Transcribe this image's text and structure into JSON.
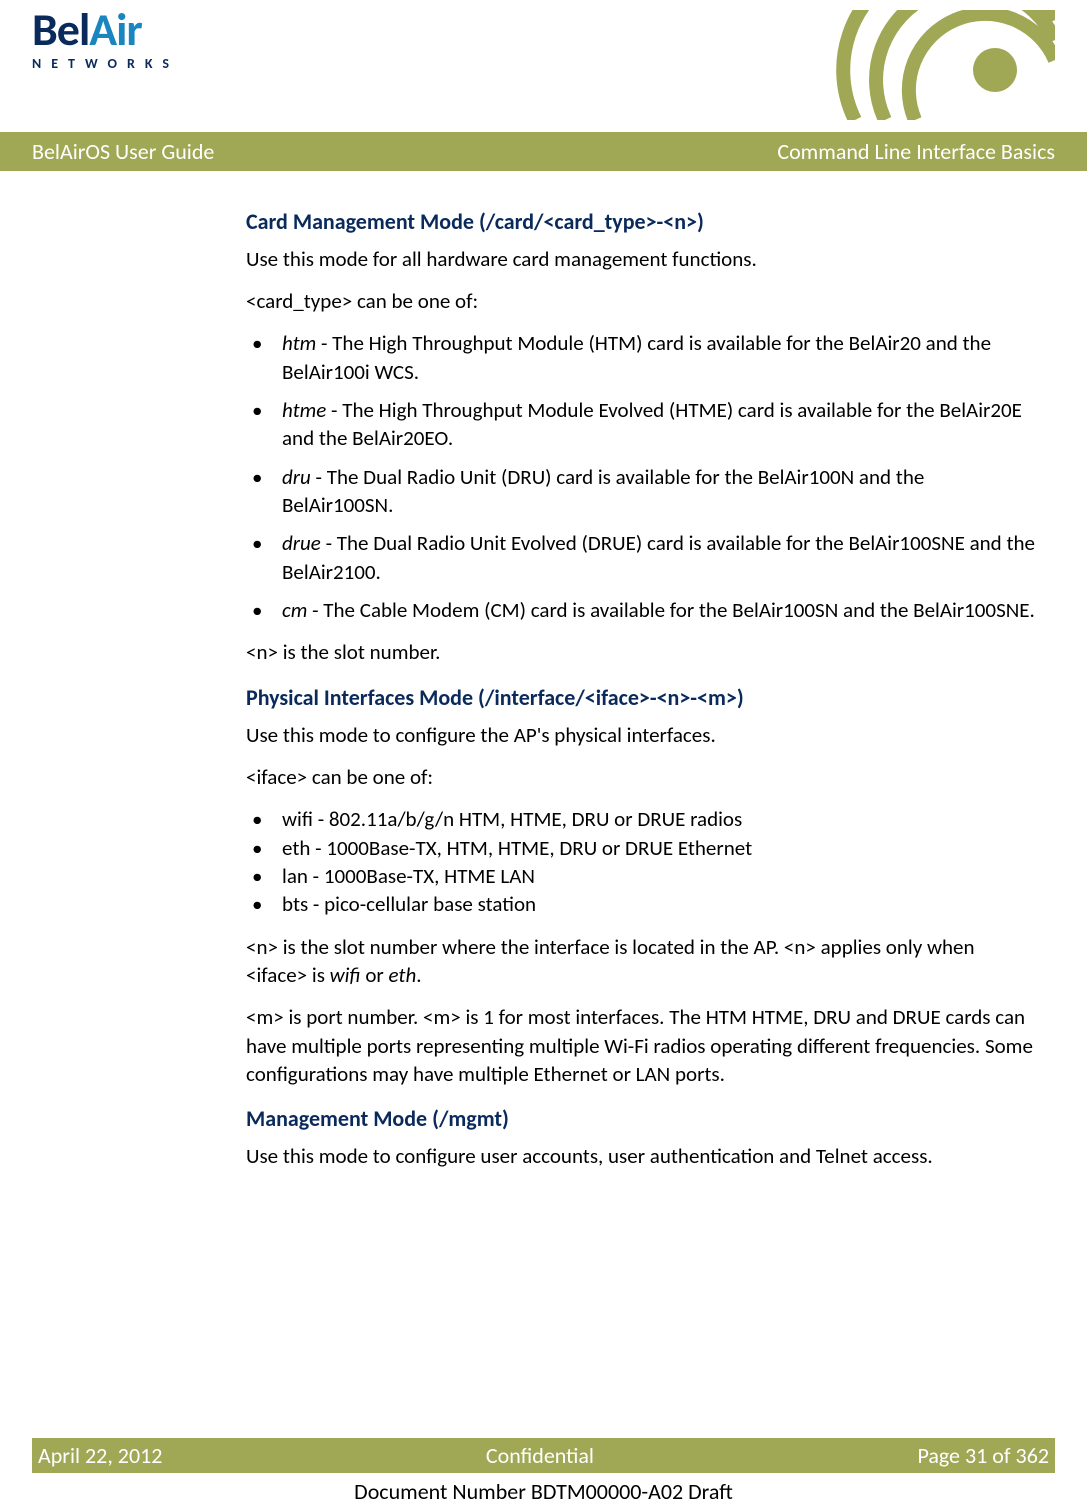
{
  "header": {
    "logo_prefix": "Bel",
    "logo_suffix": "Air",
    "logo_sub": "NETWORKS"
  },
  "titlebar": {
    "left": "BelAirOS User Guide",
    "right": "Command Line Interface Basics"
  },
  "sections": {
    "card": {
      "heading": "Card Management Mode (/card/<card_type>-<n>)",
      "intro": "Use this mode for all hardware card management functions.",
      "lead": "<card_type> can be one of:",
      "items": [
        {
          "term": "htm",
          "desc": " - The High Throughput Module (HTM) card is available for the BelAir20 and the BelAir100i WCS."
        },
        {
          "term": "htme",
          "desc": " - The High Throughput Module Evolved (HTME) card is available for the BelAir20E and the BelAir20EO."
        },
        {
          "term": "dru",
          "desc": " - The Dual Radio Unit (DRU) card is available for the BelAir100N and the BelAir100SN."
        },
        {
          "term": "drue",
          "desc": " - The Dual Radio Unit Evolved (DRUE) card is available for the BelAir100SNE and the BelAir2100."
        },
        {
          "term": "cm",
          "desc": " - The Cable Modem (CM) card is available for the BelAir100SN and the BelAir100SNE."
        }
      ],
      "trail": "<n> is the slot number."
    },
    "iface": {
      "heading": "Physical Interfaces Mode (/interface/<iface>-<n>-<m>)",
      "intro": "Use this mode to configure the AP's physical interfaces.",
      "lead": "<iface> can be one of:",
      "items": [
        "wifi - 802.11a/b/g/n HTM, HTME, DRU or DRUE radios",
        "eth - 1000Base-TX, HTM, HTME, DRU or DRUE Ethernet",
        "lan - 1000Base-TX, HTME LAN",
        "bts - pico-cellular base station"
      ],
      "n_pre": "<n> is the slot number where the interface is located in the AP. <n> applies only when <iface> is ",
      "n_term1": "wifi",
      "n_mid": " or ",
      "n_term2": "eth",
      "n_post": ".",
      "m_text": "<m> is port number. <m> is 1 for most interfaces. The HTM HTME, DRU and DRUE cards can have multiple ports representing multiple Wi-Fi radios operating different frequencies. Some configurations may have multiple Ethernet or LAN ports."
    },
    "mgmt": {
      "heading": "Management Mode (/mgmt)",
      "intro": "Use this mode to configure user accounts, user authentication and Telnet access."
    }
  },
  "footer": {
    "date": "April 22, 2012",
    "conf": "Confidential",
    "page": "Page 31 of 362",
    "docnum": "Document Number BDTM00000-A02 Draft"
  }
}
